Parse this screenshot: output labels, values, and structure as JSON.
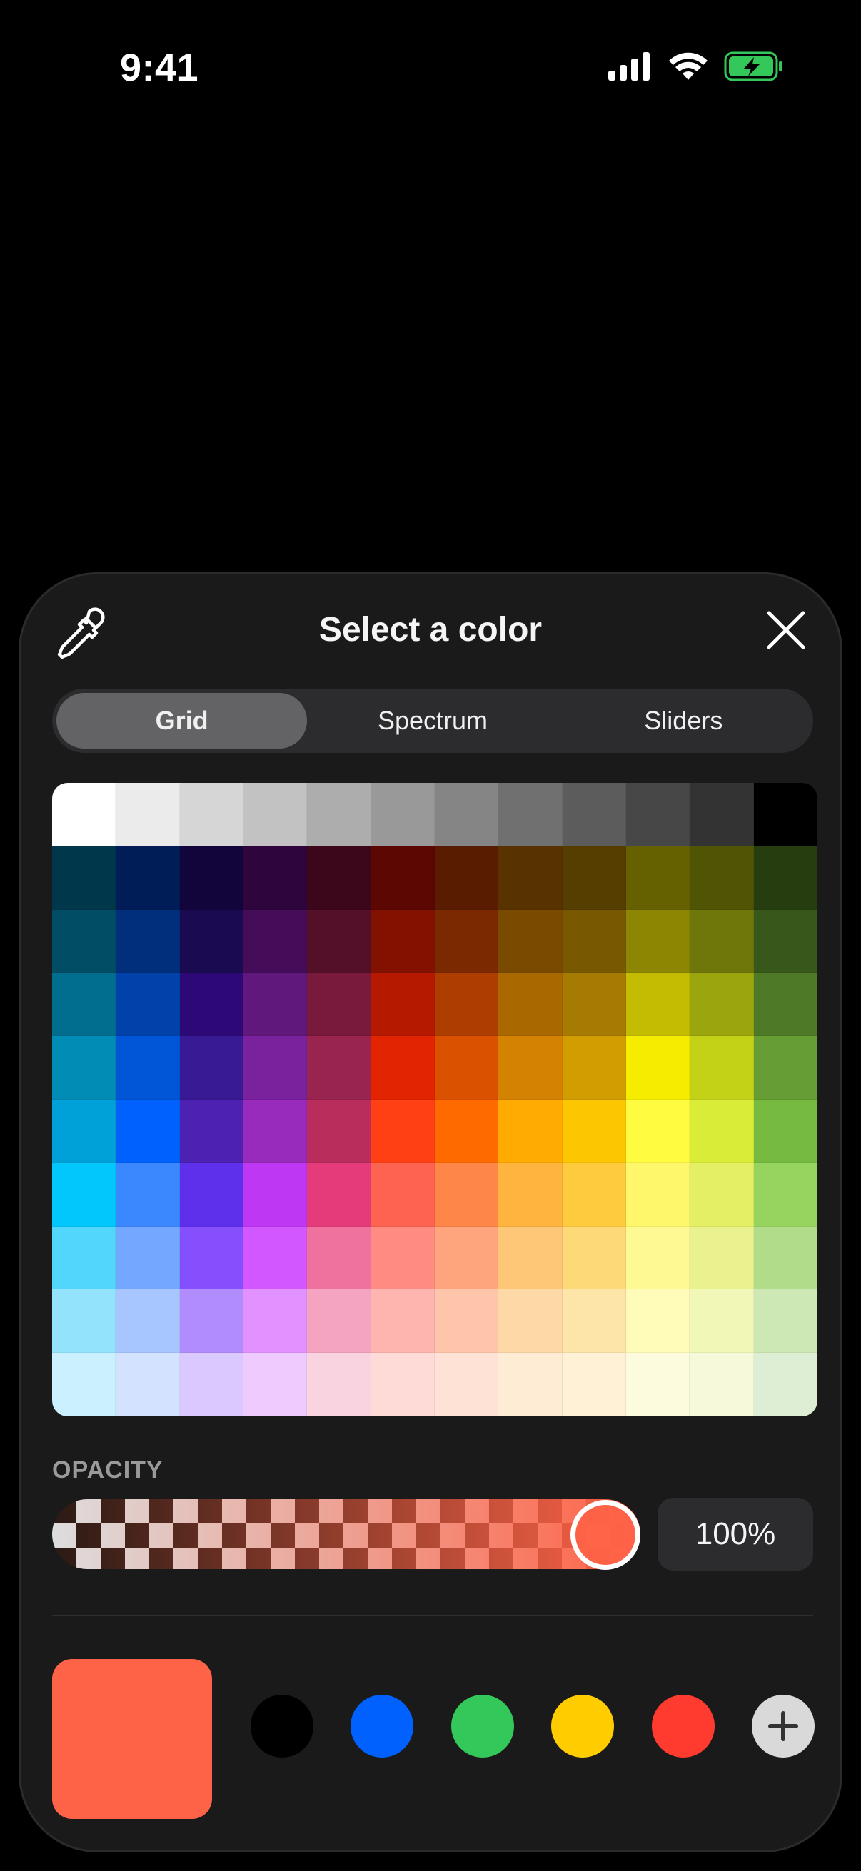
{
  "status_bar": {
    "time": "9:41",
    "icons": [
      "cellular-signal-icon",
      "wifi-icon",
      "battery-charging-icon"
    ]
  },
  "sheet": {
    "title": "Select a color",
    "eyedropper_icon": "eyedropper-icon",
    "close_icon": "close-icon",
    "tabs": [
      {
        "label": "Grid",
        "active": true
      },
      {
        "label": "Spectrum",
        "active": false
      },
      {
        "label": "Sliders",
        "active": false
      }
    ],
    "grid": [
      [
        "#ffffff",
        "#ebebeb",
        "#d6d6d6",
        "#c2c2c2",
        "#adadad",
        "#999999",
        "#858585",
        "#707070",
        "#5c5c5c",
        "#474747",
        "#333333",
        "#000000"
      ],
      [
        "#00374a",
        "#011d57",
        "#11053b",
        "#2e063d",
        "#3c071b",
        "#5c0701",
        "#5a1c00",
        "#583300",
        "#563d00",
        "#666100",
        "#4f5504",
        "#263e0f"
      ],
      [
        "#004d65",
        "#012f7b",
        "#1a0a52",
        "#450d59",
        "#551029",
        "#831100",
        "#7b2900",
        "#7a4a00",
        "#785800",
        "#8c8602",
        "#6f760a",
        "#38571a"
      ],
      [
        "#016e8f",
        "#0042a9",
        "#2c0977",
        "#61187c",
        "#791a3d",
        "#b51a00",
        "#ad3e00",
        "#a96800",
        "#a67b01",
        "#c4bc00",
        "#9ba50e",
        "#4e7a27"
      ],
      [
        "#008cb4",
        "#0056d6",
        "#371a94",
        "#7a219e",
        "#99244f",
        "#e22400",
        "#da5100",
        "#d38301",
        "#d19d01",
        "#f5ec00",
        "#c3d117",
        "#669d34"
      ],
      [
        "#00a1d8",
        "#0061fe",
        "#4d22b2",
        "#982abc",
        "#b92d5d",
        "#ff4015",
        "#ff6a00",
        "#ffab01",
        "#fcc700",
        "#fefb41",
        "#d9ec37",
        "#76bb40"
      ],
      [
        "#01c7fc",
        "#3a87fe",
        "#5e30eb",
        "#be38f3",
        "#e63b7a",
        "#fe6250",
        "#fe8648",
        "#feb43f",
        "#fecb3e",
        "#fff76b",
        "#e4ef65",
        "#96d35f"
      ],
      [
        "#52d6fc",
        "#74a7ff",
        "#864ffe",
        "#d357fe",
        "#ee719e",
        "#ff8c82",
        "#fea57d",
        "#fec777",
        "#fed977",
        "#fff994",
        "#eaf28f",
        "#b1dd8b"
      ],
      [
        "#93e3fc",
        "#a7c6ff",
        "#b18cfe",
        "#e292fe",
        "#f4a4c0",
        "#ffb5af",
        "#ffc5ab",
        "#fed9a8",
        "#fde4a8",
        "#fffbb9",
        "#f1f7b7",
        "#cde8b5"
      ],
      [
        "#cbf0ff",
        "#d3e2ff",
        "#d9c9fe",
        "#efcaff",
        "#f9d3e0",
        "#ffdbd8",
        "#ffe2d6",
        "#feecd4",
        "#fef1d5",
        "#fdfbdd",
        "#f6fadb",
        "#deeed4"
      ]
    ],
    "opacity": {
      "label": "OPACITY",
      "value": 1.0,
      "value_text": "100%"
    },
    "current_color": "#ff6347",
    "saved_colors": [
      "#000000",
      "#0061fe",
      "#34c759",
      "#ffcc00",
      "#ff3b30"
    ],
    "add_icon": "plus-icon"
  }
}
